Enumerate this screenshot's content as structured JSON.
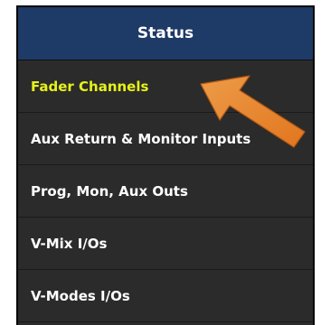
{
  "menu": {
    "header": "Status",
    "items": [
      {
        "label": "Fader Channels",
        "active": true
      },
      {
        "label": "Aux Return & Monitor Inputs",
        "active": false
      },
      {
        "label": "Prog, Mon, Aux Outs",
        "active": false
      },
      {
        "label": "V-Mix I/Os",
        "active": false
      },
      {
        "label": "V-Modes I/Os",
        "active": false
      }
    ]
  },
  "colors": {
    "header_bg": "#1e3a66",
    "panel_bg": "#2b2b2b",
    "active_text": "#e6f21a",
    "annotation_arrow": "#f0892c"
  },
  "annotation": {
    "icon": "pointer-arrow-icon"
  }
}
